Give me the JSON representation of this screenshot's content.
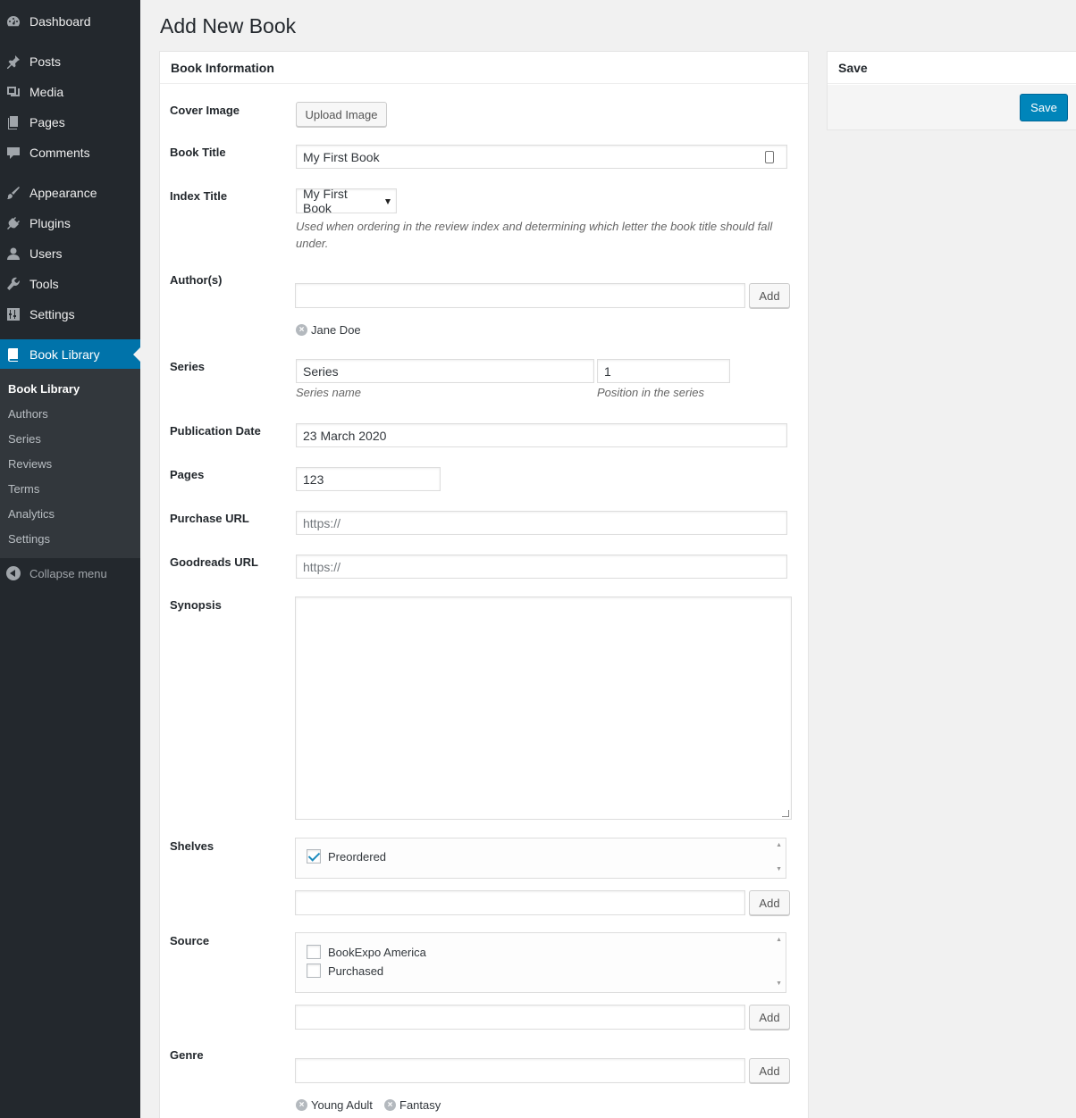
{
  "sidebar": {
    "items": [
      {
        "label": "Dashboard",
        "icon": "dashboard-icon"
      },
      {
        "label": "Posts",
        "icon": "pin-icon"
      },
      {
        "label": "Media",
        "icon": "media-icon"
      },
      {
        "label": "Pages",
        "icon": "pages-icon"
      },
      {
        "label": "Comments",
        "icon": "comment-icon"
      },
      {
        "label": "Appearance",
        "icon": "brush-icon"
      },
      {
        "label": "Plugins",
        "icon": "plug-icon"
      },
      {
        "label": "Users",
        "icon": "user-icon"
      },
      {
        "label": "Tools",
        "icon": "wrench-icon"
      },
      {
        "label": "Settings",
        "icon": "settings-icon"
      },
      {
        "label": "Book Library",
        "icon": "book-icon"
      }
    ],
    "submenu": [
      "Book Library",
      "Authors",
      "Series",
      "Reviews",
      "Terms",
      "Analytics",
      "Settings"
    ],
    "collapse": "Collapse menu",
    "accent": "#0073aa"
  },
  "page": {
    "title": "Add New Book"
  },
  "save_box": {
    "title": "Save",
    "button": "Save",
    "button_color": "#0085ba"
  },
  "book_info": {
    "title": "Book Information",
    "cover": {
      "label": "Cover Image",
      "button": "Upload Image"
    },
    "book_title": {
      "label": "Book Title",
      "value": "My First Book"
    },
    "index_title": {
      "label": "Index Title",
      "value": "My First Book",
      "description": "Used when ordering in the review index and determining which letter the book title should fall under."
    },
    "authors": {
      "label": "Author(s)",
      "value": "",
      "button": "Add",
      "tags": [
        "Jane Doe"
      ]
    },
    "series": {
      "label": "Series",
      "name_value": "Series",
      "position_value": "1",
      "name_desc": "Series name",
      "position_desc": "Position in the series"
    },
    "publication_date": {
      "label": "Publication Date",
      "value": "23 March 2020"
    },
    "pages": {
      "label": "Pages",
      "value": "123"
    },
    "purchase_url": {
      "label": "Purchase URL",
      "placeholder": "https://"
    },
    "goodreads_url": {
      "label": "Goodreads URL",
      "placeholder": "https://"
    },
    "synopsis": {
      "label": "Synopsis",
      "value": ""
    },
    "shelves": {
      "label": "Shelves",
      "options": [
        {
          "label": "Preordered",
          "checked": true
        }
      ],
      "button": "Add"
    },
    "source": {
      "label": "Source",
      "options": [
        {
          "label": "BookExpo America",
          "checked": false
        },
        {
          "label": "Purchased",
          "checked": false
        }
      ],
      "button": "Add"
    },
    "genre": {
      "label": "Genre",
      "button": "Add",
      "tags": [
        "Young Adult",
        "Fantasy"
      ]
    }
  }
}
